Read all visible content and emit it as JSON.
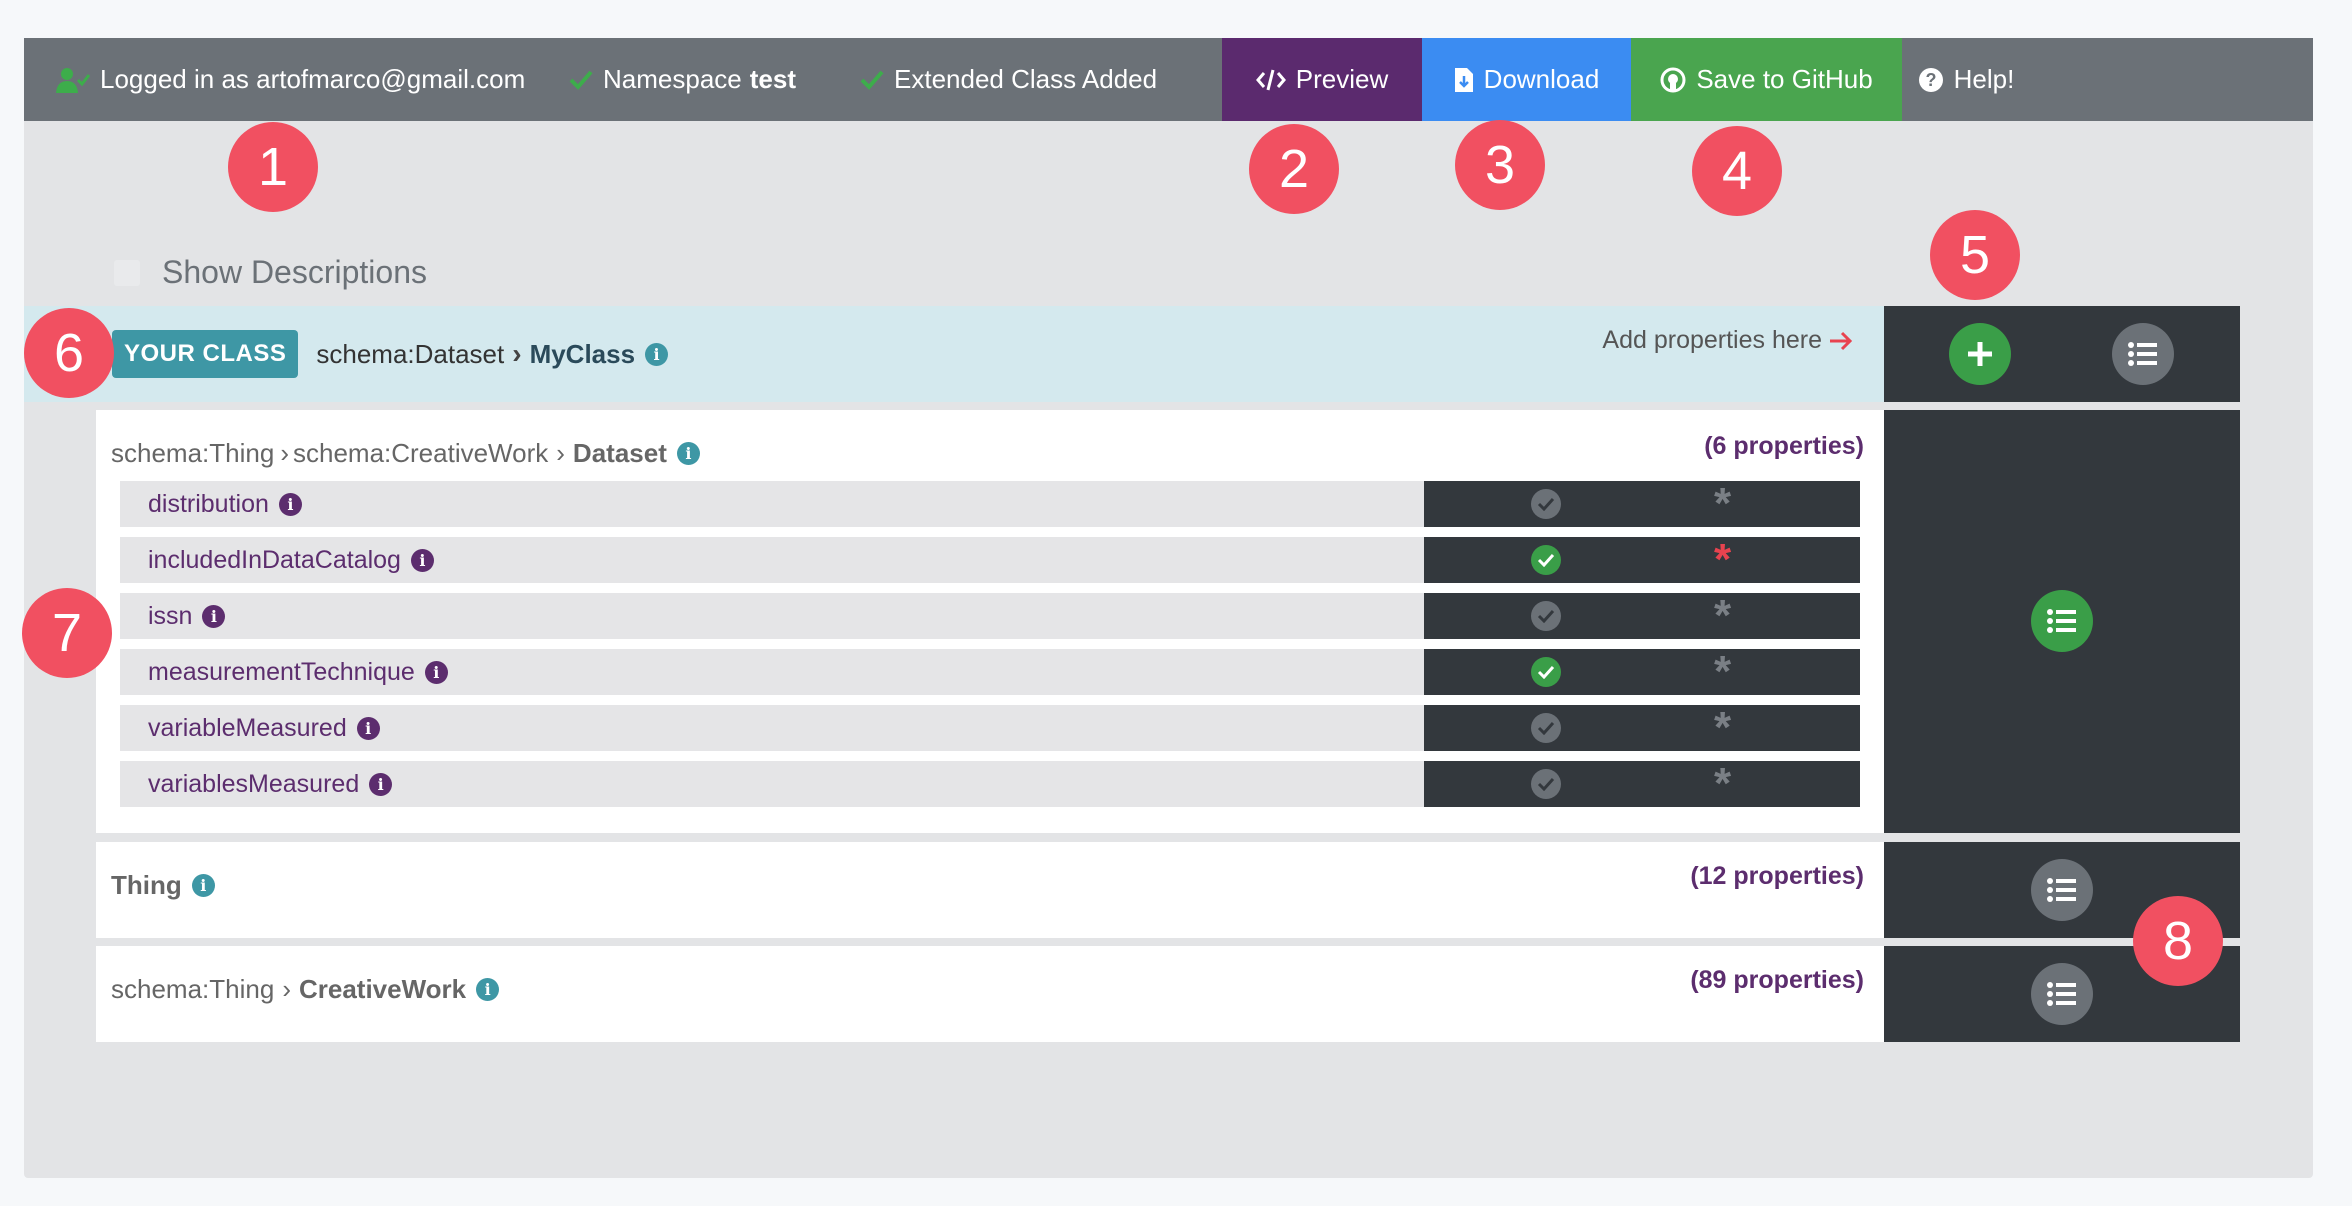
{
  "topbar": {
    "logged_in": "Logged in as artofmarco@gmail.com",
    "namespace_label": "Namespace",
    "namespace_value": "test",
    "extended_status": "Extended Class Added",
    "preview": "Preview",
    "download": "Download",
    "save_github": "Save to GitHub",
    "help": "Help!",
    "colors": {
      "bar": "#6b7177",
      "preview": "#5b2a6e",
      "download": "#3b8cf2",
      "github": "#4aa54f"
    }
  },
  "annotations": [
    "1",
    "2",
    "3",
    "4",
    "5",
    "6",
    "7",
    "8"
  ],
  "show_descriptions": "Show Descriptions",
  "your_class": {
    "badge": "YOUR CLASS",
    "parent": "schema:Dataset",
    "name": "MyClass",
    "add_properties": "Add properties here"
  },
  "dataset_card": {
    "crumb1": "schema:Thing",
    "crumb2": "schema:CreativeWork",
    "name": "Dataset",
    "count": "(6 properties)",
    "properties": [
      {
        "name": "distribution",
        "check": "grey",
        "star": "grey"
      },
      {
        "name": "includedInDataCatalog",
        "check": "green",
        "star": "red"
      },
      {
        "name": "issn",
        "check": "grey",
        "star": "grey"
      },
      {
        "name": "measurementTechnique",
        "check": "green",
        "star": "grey"
      },
      {
        "name": "variableMeasured",
        "check": "grey",
        "star": "grey"
      },
      {
        "name": "variablesMeasured",
        "check": "grey",
        "star": "grey"
      }
    ]
  },
  "thing_card": {
    "name": "Thing",
    "count": "(12 properties)"
  },
  "creativework_card": {
    "crumb1": "schema:Thing",
    "name": "CreativeWork",
    "count": "(89 properties)"
  }
}
